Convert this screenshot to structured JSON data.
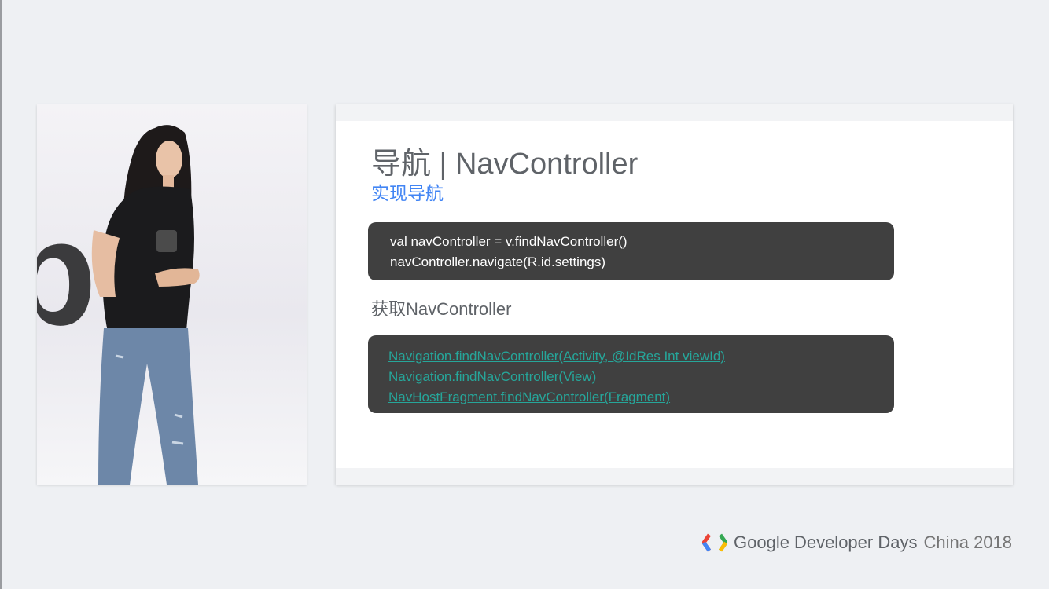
{
  "slide": {
    "title": "导航 | NavController",
    "subtitle": "实现导航",
    "code_block_1": [
      "val navController = v.findNavController()",
      "navController.navigate(R.id.settings)"
    ],
    "section_label": "获取NavController",
    "code_block_2_links": [
      "Navigation.findNavController(Activity, @IdRes Int viewId)",
      "Navigation.findNavController(View)",
      "NavHostFragment.findNavController(Fragment)"
    ]
  },
  "video": {
    "backdrop_text": "pe"
  },
  "footer": {
    "google": "Google",
    "event": "Developer Days",
    "edition": "China 2018"
  },
  "colors": {
    "subtitle": "#4285f4",
    "code_bg": "#404040",
    "link": "#26a69a",
    "logo_red": "#ea4335",
    "logo_blue": "#4285f4",
    "logo_green": "#34a853",
    "logo_yellow": "#fbbc05"
  }
}
